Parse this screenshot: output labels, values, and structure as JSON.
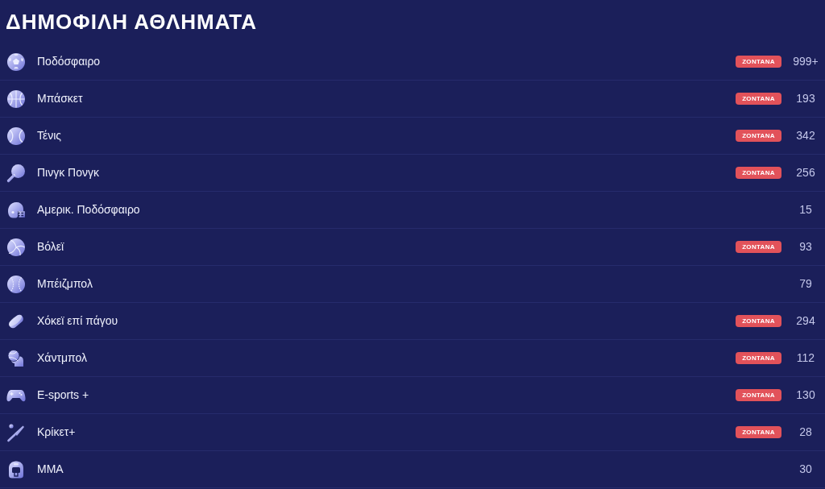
{
  "title": "ΔΗΜΟΦΙΛΗ ΑΘΛΗΜΑΤΑ",
  "sports": [
    {
      "kind": "soccer",
      "name": "Ποδόσφαιρο",
      "badge": "ZONTANA",
      "count": "999+"
    },
    {
      "kind": "basketball",
      "name": "Μπάσκετ",
      "badge": "ZONTANA",
      "count": "193"
    },
    {
      "kind": "tennis",
      "name": "Τένις",
      "badge": "ZONTANA",
      "count": "342"
    },
    {
      "kind": "tabletennis",
      "name": "Πινγκ Πονγκ",
      "badge": "ZONTANA",
      "count": "256"
    },
    {
      "kind": "americanfootball",
      "name": "Αμερικ. Ποδόσφαιρο",
      "count": "15"
    },
    {
      "kind": "volleyball",
      "name": "Βόλεϊ",
      "badge": "ZONTANA",
      "count": "93"
    },
    {
      "kind": "baseball",
      "name": "Μπέιζμπολ",
      "count": "79"
    },
    {
      "kind": "hockey",
      "name": "Χόκεϊ επί πάγου",
      "badge": "ZONTANA",
      "count": "294"
    },
    {
      "kind": "handball",
      "name": "Χάντμπολ",
      "badge": "ZONTANA",
      "count": "112"
    },
    {
      "kind": "esports",
      "name": "E-sports +",
      "badge": "ZONTANA",
      "count": "130"
    },
    {
      "kind": "cricket",
      "name": "Κρίκετ+",
      "badge": "ZONTANA",
      "count": "28"
    },
    {
      "kind": "mma",
      "name": "MMA",
      "count": "30"
    }
  ]
}
